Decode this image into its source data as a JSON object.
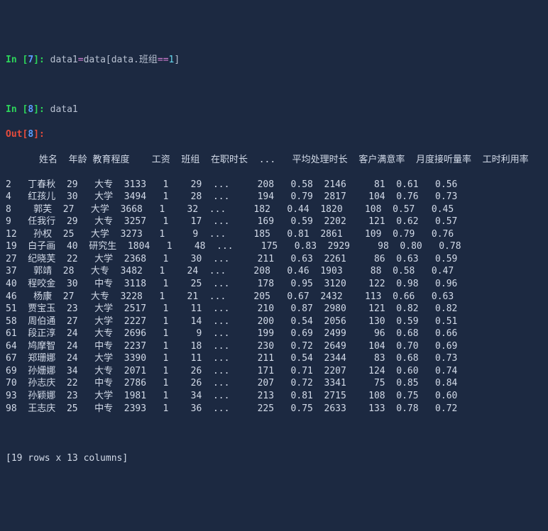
{
  "cell7": {
    "in_label": "In [",
    "in_num": "7",
    "in_close": "]: ",
    "code_lhs": "data1",
    "code_op": "=",
    "code_rhs_a": "data[data.班组",
    "code_rhs_op": "==",
    "code_rhs_num": "1",
    "code_rhs_close": "]"
  },
  "cell8": {
    "in_label": "In [",
    "in_num": "8",
    "in_close": "]: ",
    "code": "data1",
    "out_label": "Out[",
    "out_num": "8",
    "out_close": "]:"
  },
  "table": {
    "header": "      姓名  年龄 教育程度    工资  班组  在职时长  ...   平均处理时长  客户满意率  月度接听量率  工时利用率",
    "rows": [
      "2   丁春秋  29   大专  3133   1    29  ...     208   0.58  2146     81  0.61   0.56",
      "4   红孩儿  30   大学  3494   1    28  ...     194   0.79  2817    104  0.76   0.73",
      "8    郭芙  27   大学  3668   1    32  ...     182   0.44  1820    108  0.57   0.45",
      "9   任我行  29   大专  3257   1    17  ...     169   0.59  2202    121  0.62   0.57",
      "12   孙权  25   大学  3273   1     9  ...     185   0.81  2861    109  0.79   0.76",
      "19  白子画  40  研究生  1804   1    48  ...     175   0.83  2929     98  0.80   0.78",
      "27  纪晓芙  22   大学  2368   1    30  ...     211   0.63  2261     86  0.63   0.59",
      "37   郭靖  28   大专  3482   1    24  ...     208   0.46  1903     88  0.58   0.47",
      "40  程咬金  30   中专  3118   1    25  ...     178   0.95  3120    122  0.98   0.96",
      "46   杨康  27   大专  3228   1    21  ...     205   0.67  2432    113  0.66   0.63",
      "51  贾宝玉  23   大学  2517   1    11  ...     210   0.87  2980    121  0.82   0.82",
      "58  周伯通  27   大学  2227   1    14  ...     200   0.54  2056    130  0.59   0.51",
      "61  段正淳  24   大专  2696   1     9  ...     199   0.69  2499     96  0.68   0.66",
      "64  鸠摩智  24   中专  2237   1    18  ...     230   0.72  2649    104  0.70   0.69",
      "67  郑珊娜  24   大学  3390   1    11  ...     211   0.54  2344     83  0.68   0.73",
      "69  孙姗娜  34   大专  2071   1    26  ...     171   0.71  2207    124  0.60   0.74",
      "70  孙志庆  22   中专  2786   1    26  ...     207   0.72  3341     75  0.85   0.84",
      "93  孙颖娜  23   大学  1981   1    34  ...     213   0.81  2715    108  0.75   0.60",
      "98  王志庆  25   中专  2393   1    36  ...     225   0.75  2633    133  0.78   0.72"
    ],
    "footer": "[19 rows x 13 columns]"
  }
}
